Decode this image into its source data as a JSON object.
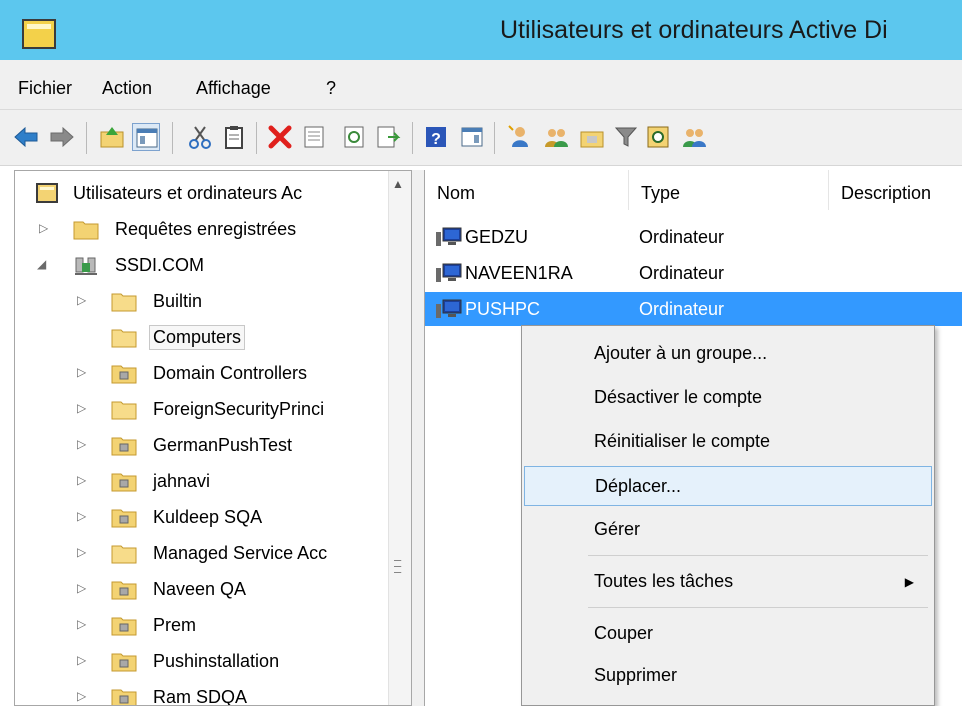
{
  "window": {
    "title": "Utilisateurs et ordinateurs Active Di",
    "icon": "folder-app-icon"
  },
  "menubar": {
    "items": [
      "Fichier",
      "Action",
      "Affichage",
      "?"
    ]
  },
  "toolbar": {
    "icons": [
      "back-arrow-icon",
      "forward-arrow-icon",
      "up-folder-icon",
      "show-console-tree-icon",
      "cut-icon",
      "copy-icon",
      "delete-icon",
      "properties-icon",
      "refresh-icon",
      "export-list-icon",
      "help-icon",
      "action-pane-icon",
      "create-user-icon",
      "create-group-icon",
      "create-ou-icon",
      "filter-icon",
      "find-icon",
      "add-to-group-icon"
    ]
  },
  "tree": {
    "root": "Utilisateurs et ordinateurs Ac",
    "saved_queries": "Requêtes enregistrées",
    "domain": "SSDI.COM",
    "containers": [
      {
        "label": "Builtin",
        "kind": "container",
        "expandable": true
      },
      {
        "label": "Computers",
        "kind": "container",
        "expandable": false,
        "selected": true
      },
      {
        "label": "Domain Controllers",
        "kind": "ou",
        "expandable": true
      },
      {
        "label": "ForeignSecurityPrinci",
        "kind": "container",
        "expandable": true
      },
      {
        "label": "GermanPushTest",
        "kind": "ou",
        "expandable": true
      },
      {
        "label": "jahnavi",
        "kind": "ou",
        "expandable": true
      },
      {
        "label": "Kuldeep SQA",
        "kind": "ou",
        "expandable": true
      },
      {
        "label": "Managed Service Acc",
        "kind": "container",
        "expandable": true
      },
      {
        "label": "Naveen QA",
        "kind": "ou",
        "expandable": true
      },
      {
        "label": "Prem",
        "kind": "ou",
        "expandable": true
      },
      {
        "label": "Pushinstallation",
        "kind": "ou",
        "expandable": true
      },
      {
        "label": "Ram SDQA",
        "kind": "ou",
        "expandable": true
      }
    ]
  },
  "list": {
    "columns": [
      "Nom",
      "Type",
      "Description"
    ],
    "rows": [
      {
        "name": "GEDZU",
        "type": "Ordinateur",
        "selected": false
      },
      {
        "name": "NAVEEN1RA",
        "type": "Ordinateur",
        "selected": false
      },
      {
        "name": "PUSHPC",
        "type": "Ordinateur",
        "selected": true
      }
    ]
  },
  "context_menu": {
    "items": [
      {
        "label": "Ajouter à un groupe...",
        "hovered": false
      },
      {
        "label": "Désactiver le compte",
        "hovered": false
      },
      {
        "label": "Réinitialiser le compte",
        "hovered": false
      },
      {
        "label": "Déplacer...",
        "hovered": true
      },
      {
        "label": "Gérer",
        "hovered": false
      },
      {
        "label": "Toutes les tâches",
        "hovered": false,
        "submenu": true
      },
      {
        "label": "Couper",
        "hovered": false
      },
      {
        "label": "Supprimer",
        "hovered": false
      }
    ]
  },
  "colors": {
    "title_bar": "#5cc7ee",
    "selection": "#3399ff",
    "menu_hover": "#e5f1fb",
    "folder": "#f3d373"
  }
}
